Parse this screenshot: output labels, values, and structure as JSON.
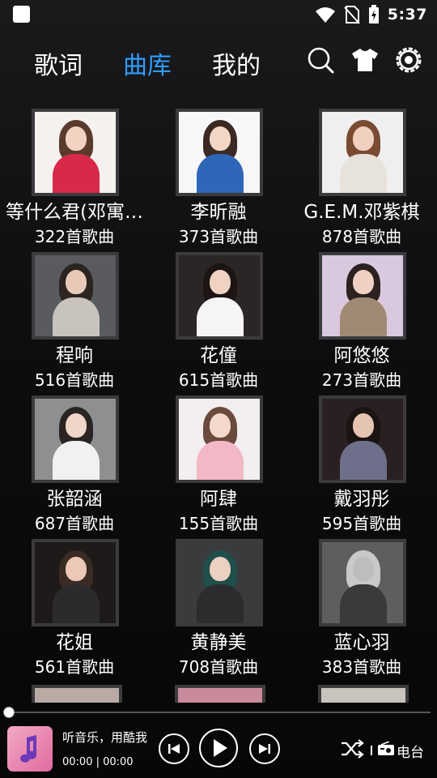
{
  "statusbar": {
    "time": "5:37"
  },
  "nav": {
    "tabs": [
      {
        "label": "歌词"
      },
      {
        "label": "曲库"
      },
      {
        "label": "我的"
      }
    ],
    "active_tab": "曲库",
    "active_color": "#2f9dff"
  },
  "artists": [
    {
      "name": "等什么君(邓寓…",
      "count": "322首歌曲"
    },
    {
      "name": "李昕融",
      "count": "373首歌曲"
    },
    {
      "name": "G.E.M.邓紫棋",
      "count": "878首歌曲"
    },
    {
      "name": "程响",
      "count": "516首歌曲"
    },
    {
      "name": "花僮",
      "count": "615首歌曲"
    },
    {
      "name": "阿悠悠",
      "count": "273首歌曲"
    },
    {
      "name": "张韶涵",
      "count": "687首歌曲"
    },
    {
      "name": "阿肆",
      "count": "155首歌曲"
    },
    {
      "name": "戴羽彤",
      "count": "595首歌曲"
    },
    {
      "name": "花姐",
      "count": "561首歌曲"
    },
    {
      "name": "黄静美",
      "count": "708首歌曲"
    },
    {
      "name": "蓝心羽",
      "count": "383首歌曲"
    }
  ],
  "player": {
    "title": "听音乐，用酷我",
    "time": "00:00 | 00:00",
    "radio_label": "电台",
    "progress": 0
  },
  "icons": {
    "search": "search-icon",
    "skin": "tshirt-icon",
    "settings": "settings-icon",
    "prev": "previous-icon",
    "play": "play-icon",
    "next": "next-icon",
    "shuffle": "shuffle-icon",
    "radio": "radio-icon"
  }
}
